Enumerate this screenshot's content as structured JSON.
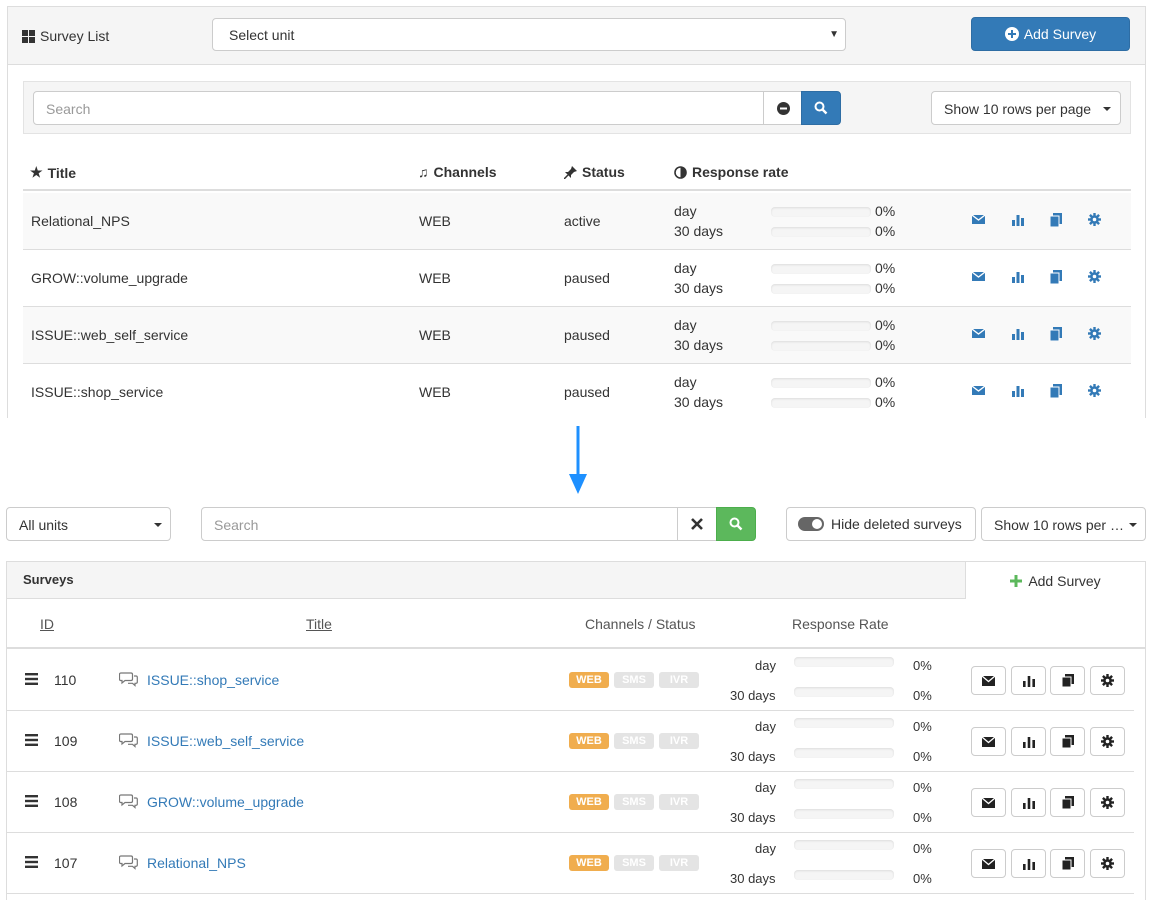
{
  "old": {
    "title": "Survey List",
    "unit_select": "Select unit",
    "add_button": "Add Survey",
    "search_placeholder": "Search",
    "rows_select": "Show 10 rows per page",
    "columns": {
      "title": "Title",
      "channels": "Channels",
      "status": "Status",
      "response": "Response rate"
    },
    "rows": [
      {
        "title": "Relational_NPS",
        "channel": "WEB",
        "status": "active",
        "day_label": "day",
        "days_label": "30 days",
        "day_pct": "0%",
        "days_pct": "0%",
        "day_rate": 0,
        "days_rate": 0
      },
      {
        "title": "GROW::volume_upgrade",
        "channel": "WEB",
        "status": "paused",
        "day_label": "day",
        "days_label": "30 days",
        "day_pct": "0%",
        "days_pct": "0%",
        "day_rate": 0,
        "days_rate": 0
      },
      {
        "title": "ISSUE::web_self_service",
        "channel": "WEB",
        "status": "paused",
        "day_label": "day",
        "days_label": "30 days",
        "day_pct": "0%",
        "days_pct": "0%",
        "day_rate": 0,
        "days_rate": 0
      },
      {
        "title": "ISSUE::shop_service",
        "channel": "WEB",
        "status": "paused",
        "day_label": "day",
        "days_label": "30 days",
        "day_pct": "0%",
        "days_pct": "0%",
        "day_rate": 0,
        "days_rate": 0
      }
    ]
  },
  "new": {
    "units_select": "All units",
    "search_placeholder": "Search",
    "hide_deleted": "Hide deleted surveys",
    "rows_select": "Show 10 rows per …",
    "panel_title": "Surveys",
    "add_button": "Add Survey",
    "columns": {
      "id": "ID",
      "title": "Title",
      "channels": "Channels / Status",
      "response": "Response Rate"
    },
    "channel_labels": [
      "WEB",
      "SMS",
      "IVR"
    ],
    "rows": [
      {
        "id": "110",
        "title": "ISSUE::shop_service",
        "day_label": "day",
        "days_label": "30 days",
        "day_pct": "0%",
        "days_pct": "0%",
        "day_rate": 0,
        "days_rate": 0
      },
      {
        "id": "109",
        "title": "ISSUE::web_self_service",
        "day_label": "day",
        "days_label": "30 days",
        "day_pct": "0%",
        "days_pct": "0%",
        "day_rate": 0,
        "days_rate": 0
      },
      {
        "id": "108",
        "title": "GROW::volume_upgrade",
        "day_label": "day",
        "days_label": "30 days",
        "day_pct": "0%",
        "days_pct": "0%",
        "day_rate": 0,
        "days_rate": 0
      },
      {
        "id": "107",
        "title": "Relational_NPS",
        "day_label": "day",
        "days_label": "30 days",
        "day_pct": "0%",
        "days_pct": "0%",
        "day_rate": 0,
        "days_rate": 0
      }
    ]
  },
  "colors": {
    "primary": "#337ab7",
    "success": "#5cb85c",
    "arrow": "#1e90ff",
    "web_badge": "#f0ad4e"
  }
}
